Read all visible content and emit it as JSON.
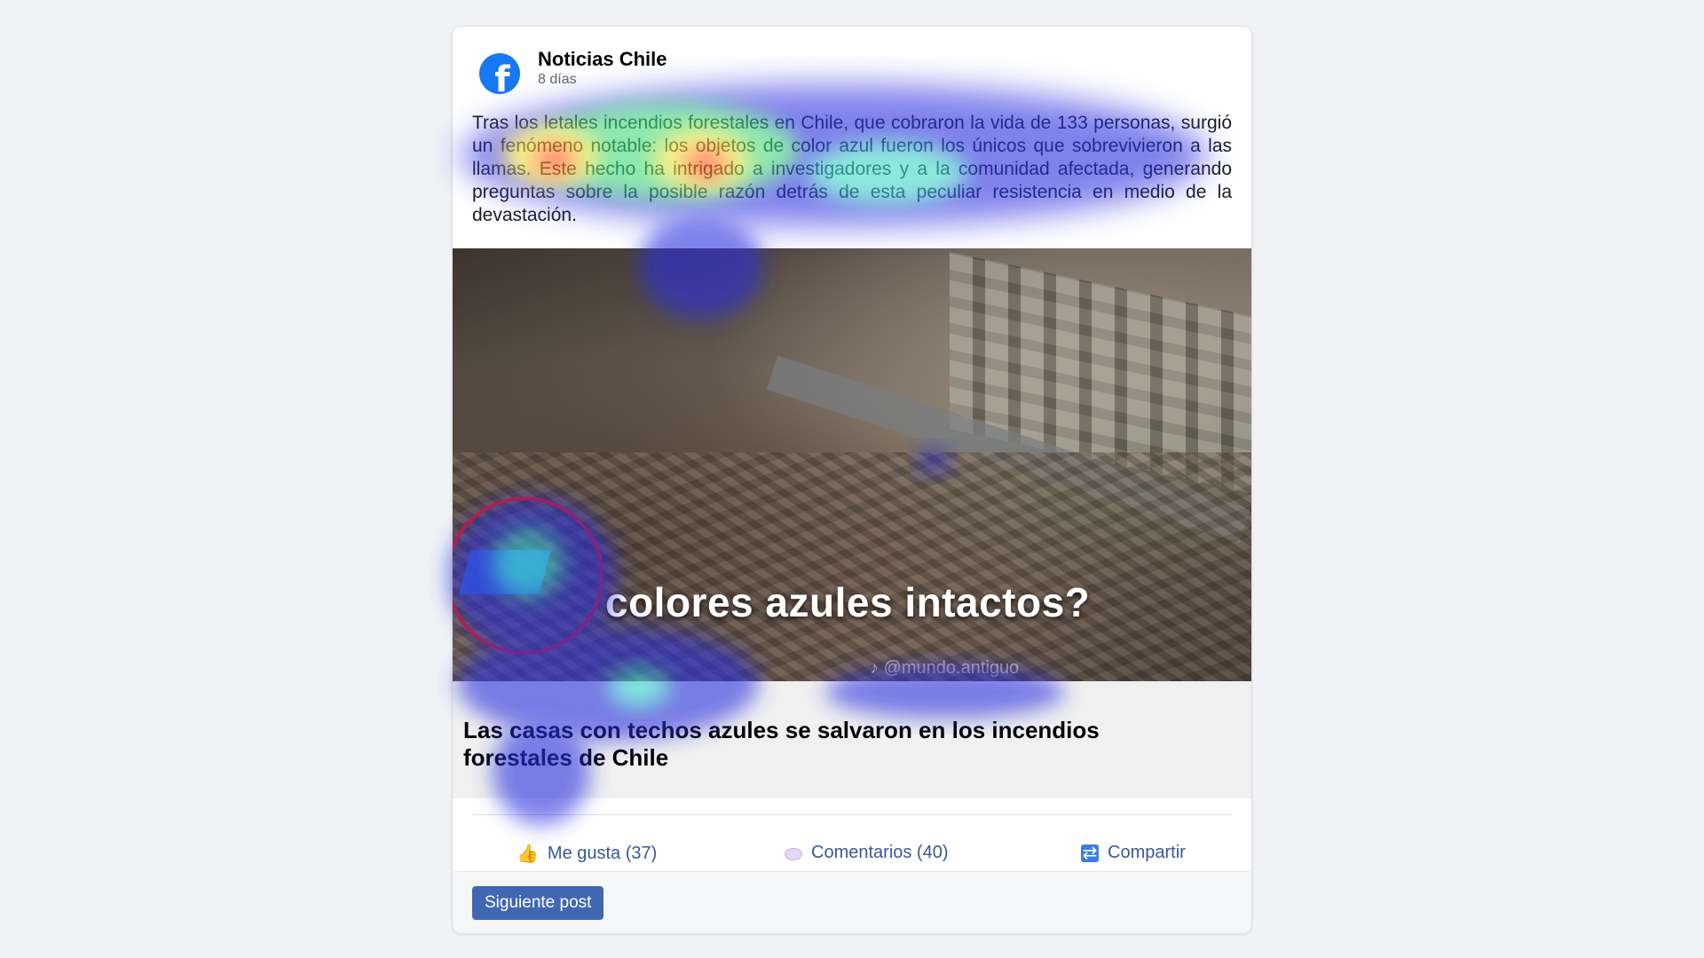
{
  "post": {
    "page_name": "Noticias Chile",
    "time": "8 días",
    "text": "Tras los letales incendios forestales en Chile, que cobraron la vida de 133 personas, surgió un fenómeno notable: los objetos de color azul fueron los únicos que sobrevivieron a las llamas. Este hecho ha intrigado a investigadores y a la comunidad afectada, generando preguntas sobre la posible razón detrás de esta peculiar resistencia en medio de la devastación.",
    "image": {
      "caption": "colores azules intactos?",
      "watermark": "♪ @mundo.antiguo"
    },
    "link_title": "Las casas con techos azules se salvaron en los incendios forestales de Chile"
  },
  "actions": {
    "like_label": "Me gusta (37)",
    "comment_label": "Comentarios (40)",
    "share_label": "Compartir"
  },
  "footer": {
    "next_label": "Siguiente post"
  },
  "icons": {
    "logo": "facebook-logo",
    "like": "thumbs-up-icon",
    "comment": "comment-bubble-icon",
    "share": "share-icon"
  },
  "colors": {
    "facebook_blue": "#1877f2",
    "action_blue": "#385898",
    "button_blue": "#4267b2",
    "caption_circle": "#e01a1a"
  }
}
